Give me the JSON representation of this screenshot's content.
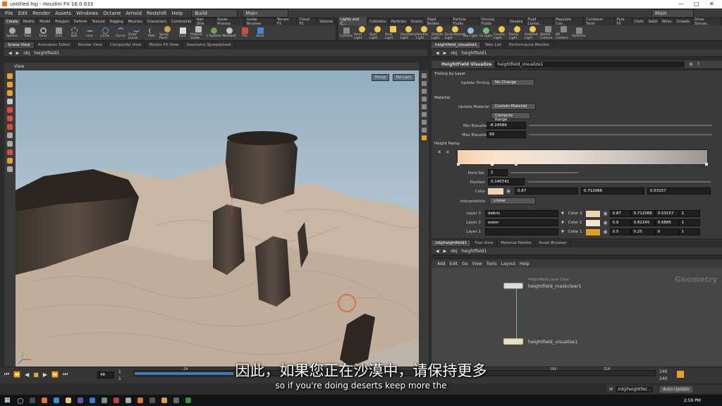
{
  "window": {
    "title": "untitled.hip - Houdini FX 16.0.633"
  },
  "menu": {
    "items": [
      "File",
      "Edit",
      "Render",
      "Assets",
      "Windows",
      "Octane",
      "Arnold",
      "Redshift",
      "Help"
    ],
    "desktop": "Build",
    "desktop_right": "Main",
    "main_right": "Main"
  },
  "shelf_left": {
    "tabs": [
      "Create",
      "Modify",
      "Model",
      "Polygon",
      "Deform",
      "Texture",
      "Rigging",
      "Muscles",
      "Characters",
      "Constraints",
      "Hair Utils",
      "Guide Process",
      "Guide Brushes",
      "Terrain FX",
      "Cloud FX",
      "Volume"
    ],
    "tools": [
      "Sphere",
      "Tube",
      "Torus",
      "Grid",
      "Null",
      "Line",
      "Circle",
      "Curve",
      "Draw Curve",
      "Path",
      "Spray Paint",
      "Font",
      "Platonic Solids",
      "L-System",
      "Metaball",
      "File",
      "base"
    ]
  },
  "shelf_right": {
    "tabs": [
      "Lights and C...",
      "Collisions",
      "Particles",
      "Grains",
      "Rigid Bodies",
      "Particle Fluids",
      "Viscous Fluids",
      "Oceans",
      "Fluid Contai...",
      "Populate Con...",
      "Container Tools",
      "Pyro FX",
      "Cloth",
      "Solid",
      "Wires",
      "Crowds",
      "Drive Simula..."
    ],
    "tools": [
      "Camera",
      "Point Light",
      "Spot Light",
      "Area Light",
      "Geometry Light",
      "Volume Light",
      "Distant Light",
      "Environment Light",
      "Sky Light",
      "GI Light",
      "Caustic Light",
      "Portal Light",
      "Ambient Light",
      "Stereo Camera",
      "VR Camera",
      "Switcher"
    ]
  },
  "scene_tabs": [
    "Scene View",
    "Animation Editor",
    "Render View",
    "Composite View",
    "Motion FX View",
    "Geometry Spreadsheet"
  ],
  "scene_path": {
    "obj": "obj",
    "node": "heightfield1"
  },
  "view": {
    "label": "View",
    "persp": "Persp",
    "cam": "No cam"
  },
  "param_tabs": [
    "heightfield_visualize1",
    "Take List",
    "Performance Monitor"
  ],
  "param_path": {
    "obj": "obj",
    "node": "heightfield1"
  },
  "param": {
    "type": "HeightField Visualize",
    "name": "heightfield_visualize1",
    "tinting_section": "Tinting by Layer",
    "update_tinting_label": "Update Tinting",
    "update_tinting": "No Change",
    "material_section": "Material",
    "update_material_label": "Update Material",
    "update_material": "Custom Material",
    "compute_range": "Compute Range",
    "min_elev_label": "Min Elevation",
    "min_elev": "-8.24589",
    "max_elev_label": "Max Elevation",
    "max_elev": "99",
    "ramp_section": "Height Ramp",
    "point_no_label": "Point No.",
    "point_no": "2",
    "position_label": "Position",
    "position": "0.140741",
    "color_label": "Color",
    "color_r": "0.87",
    "color_g": "0.712066",
    "color_b": "0.53157",
    "interp_label": "Interpolation",
    "interp": "Linear",
    "layers": [
      {
        "label": "Layer 3",
        "name": "debris",
        "color_label": "Color 3",
        "r": "0.87",
        "g": "0.712066",
        "b": "0.53157",
        "a": "1",
        "swatch": "#f2d3b3"
      },
      {
        "label": "Layer 2",
        "name": "water",
        "color_label": "Color 2",
        "r": "0.9",
        "g": "0.82245",
        "b": "0.6885",
        "a": "1",
        "swatch": "#f5e6cf"
      },
      {
        "label": "Layer 1",
        "name": "",
        "color_label": "Color 1",
        "r": "0.5",
        "g": "0.25",
        "b": "0",
        "a": "1",
        "swatch": "#e0a020"
      }
    ]
  },
  "network_tabs": [
    "/obj/heightfield1",
    "Tree View",
    "Material Palette",
    "Asset Browser"
  ],
  "network_path": {
    "obj": "obj",
    "node": "heightfield1"
  },
  "network_menu": [
    "Add",
    "Edit",
    "Go",
    "View",
    "Tools",
    "Layout",
    "Help"
  ],
  "network": {
    "watermark": "Geometry",
    "node1_type": "HeightField Layer Clear",
    "node1_name": "heightfield_maskclear1",
    "node2_name": "heightfield_visualize1"
  },
  "timeline": {
    "frame": "48",
    "start": "1",
    "start2": "1",
    "end": "240",
    "end2": "240",
    "ticks": [
      "24",
      "192",
      "216"
    ],
    "auto_update": "Auto Update",
    "path": "/obj/heightfiel..."
  },
  "subtitles": {
    "cn": "因此，如果您正在沙漠中，请保持更多",
    "en": "so if you're doing deserts keep more the"
  },
  "taskbar": {
    "time": "2:59 PM"
  }
}
